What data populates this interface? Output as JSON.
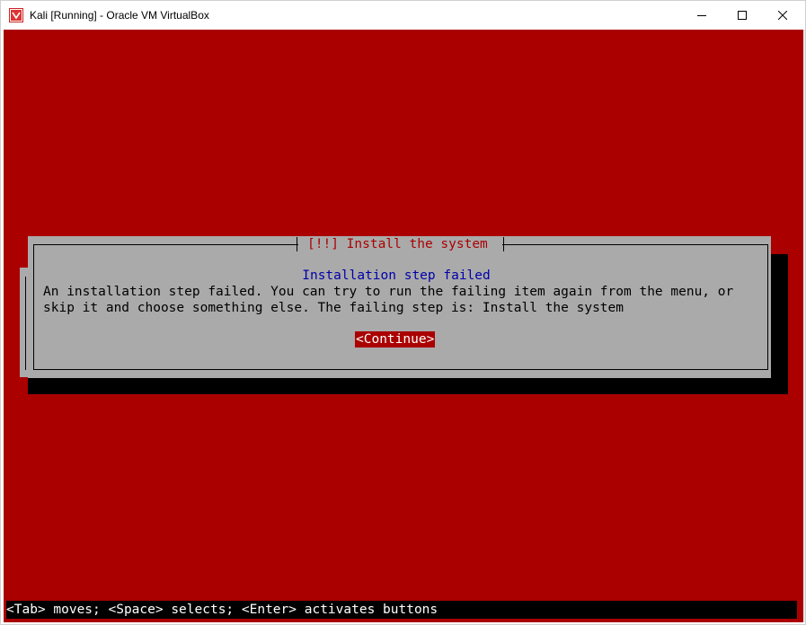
{
  "window": {
    "title": "Kali [Running] - Oracle VM VirtualBox",
    "icon": "virtualbox-icon",
    "controls": [
      "minimize-icon",
      "maximize-icon",
      "close-icon"
    ]
  },
  "dialog": {
    "title": "[!!] Install the system",
    "heading": "Installation step failed",
    "body_line_1": "An installation step failed. You can try to run the failing item again from the menu, or",
    "body_line_2": "skip it and choose something else. The failing step is: Install the system",
    "continue_label": "<Continue>"
  },
  "help_line": "<Tab> moves; <Space> selects; <Enter> activates buttons",
  "colors": {
    "console_background": "#aa0000",
    "dialog_background": "#aaaaaa",
    "heading_text": "#0000aa",
    "title_text": "#aa0000",
    "selected_button": "#aa0000"
  }
}
